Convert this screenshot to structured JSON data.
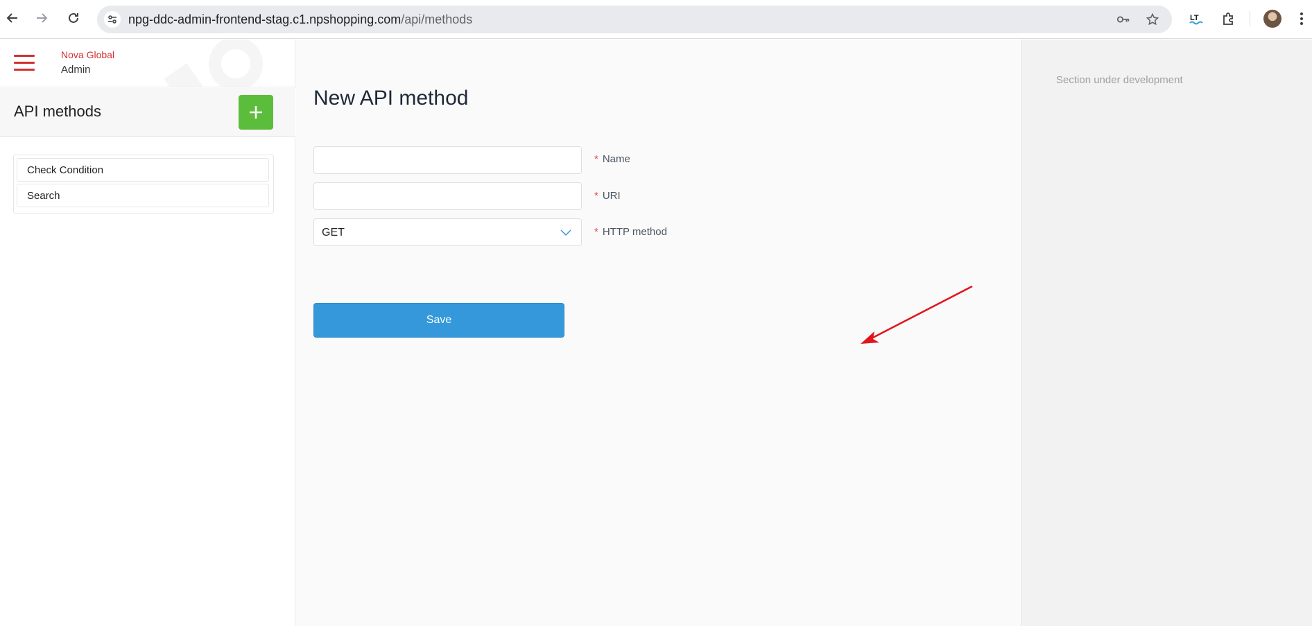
{
  "browser": {
    "url_host": "npg-ddc-admin-frontend-stag.c1.npshopping.com",
    "url_path": "/api/methods"
  },
  "sidebar": {
    "brand_name": "Nova Global",
    "brand_sub": "Admin",
    "list_title": "API methods",
    "items": [
      {
        "label": "Check Condition"
      },
      {
        "label": "Search"
      }
    ]
  },
  "form": {
    "title": "New API method",
    "name_value": "",
    "name_label": "Name",
    "uri_value": "",
    "uri_label": "URI",
    "http_method_value": "GET",
    "http_method_label": "HTTP method",
    "required_mark": "*",
    "save_label": "Save"
  },
  "right_panel": {
    "note": "Section under development"
  },
  "colors": {
    "brand_red": "#d32f2f",
    "add_green": "#5cbd3c",
    "save_blue": "#3498db",
    "annotation_red": "#e0161c"
  }
}
